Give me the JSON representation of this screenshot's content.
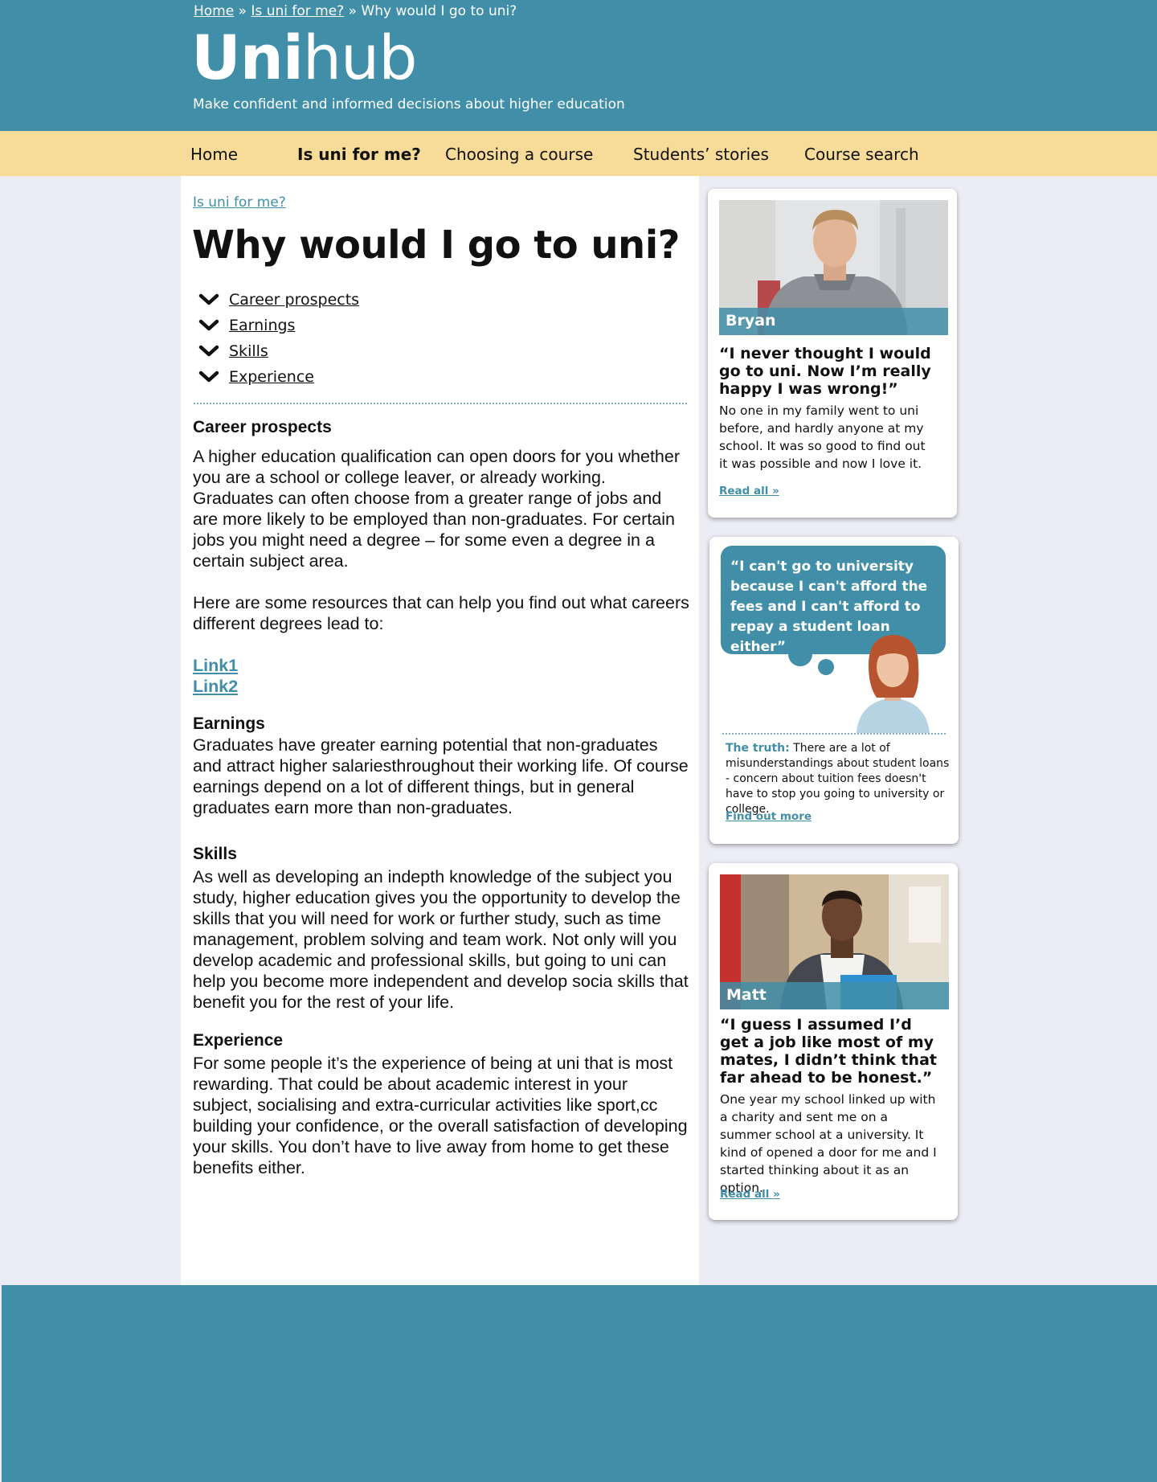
{
  "breadcrumb": {
    "home": "Home",
    "sep1": "»",
    "parent": "Is uni for me?",
    "sep2": "»",
    "current": "Why would I go to uni?"
  },
  "brand": {
    "logo_bold": "Uni",
    "logo_light": "hub",
    "tagline": "Make confident and informed decisions about higher education"
  },
  "nav": {
    "items": [
      {
        "label": "Home"
      },
      {
        "label": "Is uni for me?"
      },
      {
        "label": "Choosing a course"
      },
      {
        "label": "Students’ stories"
      },
      {
        "label": "Course search"
      }
    ],
    "active": "Is uni for me?"
  },
  "main": {
    "section_link": "Is uni for me?",
    "title": "Why would I go to uni?",
    "toc": [
      "Career prospects",
      "Earnings",
      "Skills",
      "Experience"
    ],
    "career": {
      "heading": "Career prospects",
      "para1": "A higher education qualification can open doors for you whether you are a school or college leaver, or already working. Graduates can often choose from a greater range of jobs and are more likely to be employed than non-graduates. For certain jobs you might need a degree – for some even a degree in a certain subject area.",
      "para2": "Here are some resources that can help you find out what careers different degrees lead to:",
      "links": [
        "Link1",
        "Link2"
      ]
    },
    "earnings": {
      "heading": "Earnings",
      "para": "Graduates have greater earning potential that non-graduates and attract higher salariesthroughout their working life. Of course earnings depend on a lot of different things, but in general graduates earn more than non-graduates."
    },
    "skills": {
      "heading": "Skills",
      "para": "As well as developing an indepth knowledge of the subject you study, higher education gives you the opportunity to develop the skills that you will need for work or further study, such as time management, problem solving and team work. Not only will you develop academic and professional skills, but going to uni can help you become more independent and develop socia skills that benefit you for the rest of your life."
    },
    "experience": {
      "heading": "Experience",
      "para": "For some people it’s the experience of being at uni that is most rewarding. That could be about academic interest in your subject, socialising and extra-curricular activities like sport,cc building your confidence, or the overall satisfaction of developing your skills. You don’t have to live away from home to get these benefits either."
    }
  },
  "sidebar": {
    "bryan": {
      "name": "Bryan",
      "quote": "“I never thought I would go to uni. Now I’m really happy I was wrong!”",
      "body": "No one in my family went to uni before, and hardly anyone at my school. It was so good to find out it was possible and now I love it.",
      "read_all": "Read all »"
    },
    "myth": {
      "bubble": "“I can't go to university because I can't afford the fees and I can't afford to repay a student loan either”",
      "truth_label": "The truth:",
      "truth_text": "There are a lot of misunderstandings about student loans - concern about tuition fees doesn't have to stop you going to university or college.",
      "find_out": "Find out more"
    },
    "matt": {
      "name": "Matt",
      "quote": "“I guess I assumed I’d get a job like most of my mates, I didn’t think that far ahead to be honest.”",
      "body": "One year my school linked up with a charity and sent me on a summer school at a university. It kind of opened a door for me and I started thinking about it as an option.",
      "read_all": "Read all »"
    }
  },
  "colors": {
    "brand_teal": "#418ea8",
    "nav_yellow": "#f7db98",
    "page_bg": "#ececf5"
  }
}
